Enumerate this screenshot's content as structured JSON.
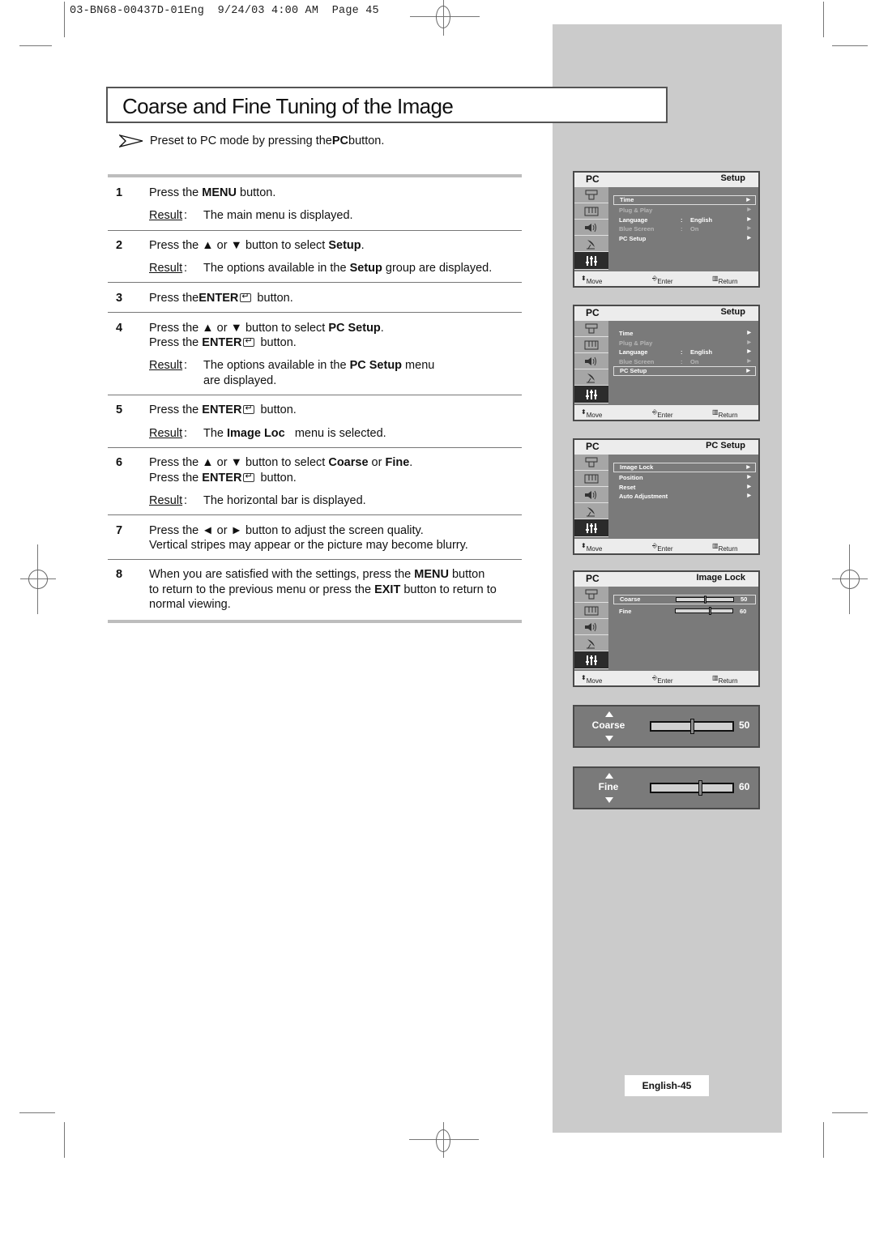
{
  "print_header": "03-BN68-00437D-01Eng  9/24/03 4:00 AM  Page 45",
  "title": "Coarse and Fine Tuning of the Image",
  "note": {
    "prefix": "Preset to PC mode by pressing the ",
    "bold": "PC",
    "suffix": " button."
  },
  "result_label": "Result",
  "steps": [
    {
      "num": "1",
      "line1": [
        "Press the ",
        "MENU",
        " button."
      ],
      "result": "The main menu is displayed."
    },
    {
      "num": "2",
      "line1": [
        "Press the ▲ or ▼ button to select ",
        "Setup",
        "."
      ],
      "result": [
        "The options available in the ",
        "Setup",
        " group are displayed."
      ]
    },
    {
      "num": "3",
      "line1": [
        "Press the",
        "ENTER",
        " button."
      ]
    },
    {
      "num": "4",
      "line1": [
        "Press the ▲ or ▼ button to select ",
        "PC Setup",
        "."
      ],
      "line2": [
        "Press the ",
        "ENTER",
        " button."
      ],
      "result": [
        "The options available in the ",
        "PC Setup",
        " menu"
      ],
      "result2": "are displayed."
    },
    {
      "num": "5",
      "line1": [
        "Press the ",
        "ENTER",
        " button."
      ],
      "result": [
        "The ",
        "Image Loc",
        "   menu is selected."
      ]
    },
    {
      "num": "6",
      "line1": [
        "Press the ▲ or ▼ button to select ",
        "Coarse",
        " or ",
        "Fine",
        "."
      ],
      "line2": [
        "Press the ",
        "ENTER",
        " button."
      ],
      "result": "The horizontal bar is displayed."
    },
    {
      "num": "7",
      "line1": "Press the ◄ or ► button to adjust the screen quality.",
      "line2": "Vertical stripes may appear or the picture may become blurry."
    },
    {
      "num": "8",
      "line1": [
        "When you are satisfied with the settings, press the ",
        "MENU",
        " button"
      ],
      "line2": [
        "to return to the previous menu or press the ",
        "EXIT",
        " button to return to"
      ],
      "line3": "normal viewing."
    }
  ],
  "osd_common": {
    "source": "PC",
    "footer": {
      "move": "Move",
      "enter": "Enter",
      "return": "Return"
    },
    "icons": [
      "input-icon",
      "picture-icon",
      "sound-icon",
      "channel-icon",
      "setup-icon"
    ]
  },
  "osd_screens": [
    {
      "title": "Setup",
      "items": [
        {
          "label": "Time",
          "selected": true,
          "dim": false
        },
        {
          "label": "Plug & Play",
          "dim": true
        },
        {
          "label": "Language",
          "value": "English",
          "dim": false
        },
        {
          "label": "Blue Screen",
          "value": "On",
          "dim": true
        },
        {
          "label": "PC Setup",
          "dim": false
        }
      ]
    },
    {
      "title": "Setup",
      "items": [
        {
          "label": "Time",
          "dim": false
        },
        {
          "label": "Plug & Play",
          "dim": true
        },
        {
          "label": "Language",
          "value": "English",
          "dim": false
        },
        {
          "label": "Blue Screen",
          "value": "On",
          "dim": true
        },
        {
          "label": "PC Setup",
          "selected": true,
          "dim": false
        }
      ]
    },
    {
      "title": "PC Setup",
      "items": [
        {
          "label": "Image Lock",
          "selected": true
        },
        {
          "label": "Position"
        },
        {
          "label": "Reset"
        },
        {
          "label": "Auto Adjustment"
        }
      ]
    },
    {
      "title": "Image Lock",
      "sliders": [
        {
          "label": "Coarse",
          "value": "50",
          "fraction": 0.5,
          "selected": true
        },
        {
          "label": "Fine",
          "value": "60",
          "fraction": 0.6
        }
      ]
    }
  ],
  "big_sliders": [
    {
      "label": "Coarse",
      "value": "50",
      "fraction": 0.5
    },
    {
      "label": "Fine",
      "value": "60",
      "fraction": 0.6
    }
  ],
  "page_label": "English-45"
}
